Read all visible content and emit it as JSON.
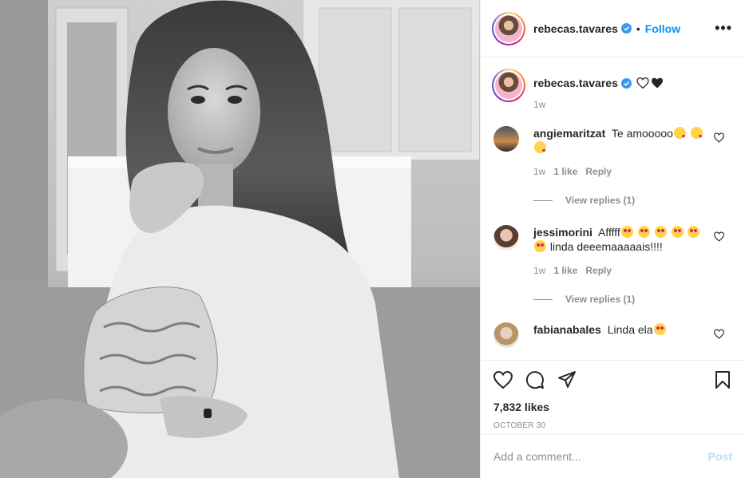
{
  "post": {
    "username": "rebecas.tavares",
    "follow_label": "Follow",
    "separator": "•",
    "more_icon": "more-horizontal-icon",
    "more_label": "•••"
  },
  "caption": {
    "username": "rebecas.tavares",
    "text_icons": [
      "white-heart-icon",
      "black-heart-icon"
    ],
    "time": "1w"
  },
  "comments": [
    {
      "username": "angiemaritzat",
      "text": "Te amooooo",
      "emoji": [
        "kiss",
        "kiss",
        "kiss"
      ],
      "time": "1w",
      "likes": "1 like",
      "reply": "Reply",
      "view_replies": "View replies (1)"
    },
    {
      "username": "jessimorini",
      "text": "Afffff",
      "text2": " linda deeemaaaaais!!!!",
      "emoji": [
        "heart-eyes",
        "heart-eyes",
        "heart-eyes",
        "heart-eyes",
        "heart-eyes",
        "heart-eyes"
      ],
      "time": "1w",
      "likes": "1 like",
      "reply": "Reply",
      "view_replies": "View replies (1)"
    },
    {
      "username": "fabianabales",
      "text": "Linda ela",
      "emoji": [
        "heart-eyes"
      ]
    }
  ],
  "actions": {
    "likes": "7,832 likes",
    "date": "OCTOBER 30"
  },
  "add_comment": {
    "placeholder": "Add a comment...",
    "post_label": "Post"
  },
  "colors": {
    "accent": "#0095f6",
    "post_disabled": "#b2dffc",
    "muted": "#8e8e8e",
    "text": "#262626"
  }
}
